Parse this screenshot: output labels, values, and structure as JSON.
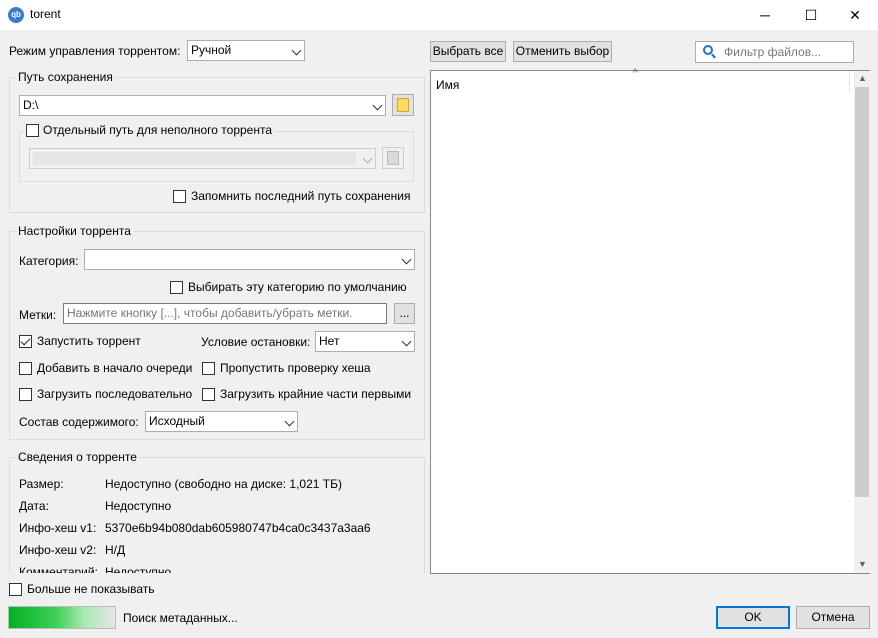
{
  "window": {
    "title": "torent",
    "app_icon": "qb",
    "minimize": "─",
    "maximize": "☐",
    "close": "✕"
  },
  "mode": {
    "label": "Режим управления торрентом:",
    "value": "Ручной"
  },
  "save_path": {
    "group_title": "Путь сохранения",
    "path": "D:\\",
    "separate_path_label": "Отдельный путь для неполного торрента",
    "incomplete_path": "",
    "remember_label": "Запомнить последний путь сохранения"
  },
  "torrent_settings": {
    "group_title": "Настройки торрента",
    "category_label": "Категория:",
    "category_value": "",
    "default_category_label": "Выбирать эту категорию по умолчанию",
    "tags_label": "Метки:",
    "tags_placeholder": "Нажмите кнопку [...], чтобы добавить/убрать метки.",
    "tags_button": "...",
    "start_torrent": "Запустить торрент",
    "stop_condition_label": "Условие остановки:",
    "stop_condition_value": "Нет",
    "add_top_queue": "Добавить в начало очереди",
    "skip_hash_check": "Пропустить проверку хеша",
    "sequential": "Загрузить последовательно",
    "first_last": "Загрузить крайние части первыми",
    "content_layout_label": "Состав содержимого:",
    "content_layout_value": "Исходный"
  },
  "info": {
    "group_title": "Сведения о торренте",
    "rows": [
      {
        "k": "Размер:",
        "v": "Недоступно (свободно на диске: 1,021 ТБ)"
      },
      {
        "k": "Дата:",
        "v": "Недоступно"
      },
      {
        "k": "Инфо-хеш v1:",
        "v": "5370e6b94b080dab605980747b4ca0c3437a3aa6"
      },
      {
        "k": "Инфо-хеш v2:",
        "v": "Н/Д"
      },
      {
        "k": "Комментарий:",
        "v": "Недоступно"
      }
    ]
  },
  "files": {
    "select_all": "Выбрать все",
    "select_none": "Отменить выбор",
    "filter_placeholder": "Фильтр файлов...",
    "column_name": "Имя"
  },
  "footer": {
    "dont_show": "Больше не показывать",
    "status": "Поиск метаданных...",
    "ok": "OK",
    "cancel": "Отмена"
  },
  "colors": {
    "progress": "#06b025",
    "accent": "#0078d7"
  }
}
